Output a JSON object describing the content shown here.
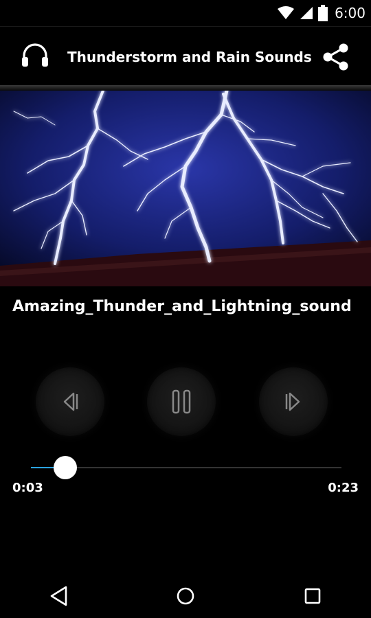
{
  "status_bar": {
    "time": "6:00",
    "icons": [
      "wifi-icon",
      "signal-icon",
      "battery-icon"
    ]
  },
  "app_bar": {
    "title": "Thunderstorm and Rain Sounds",
    "left_icon": "headphones-icon",
    "right_icon": "share-icon"
  },
  "player": {
    "track_title": "Amazing_Thunder_and_Lightning_sound",
    "controls": [
      "previous-icon",
      "pause-icon",
      "next-icon"
    ],
    "elapsed": "0:03",
    "total": "0:23",
    "progress_fraction": 0.11
  },
  "nav": {
    "buttons": [
      "back-icon",
      "home-icon",
      "recents-icon"
    ]
  },
  "colors": {
    "background": "#000000",
    "accent": "#2aa3e0",
    "text": "#ffffff"
  }
}
